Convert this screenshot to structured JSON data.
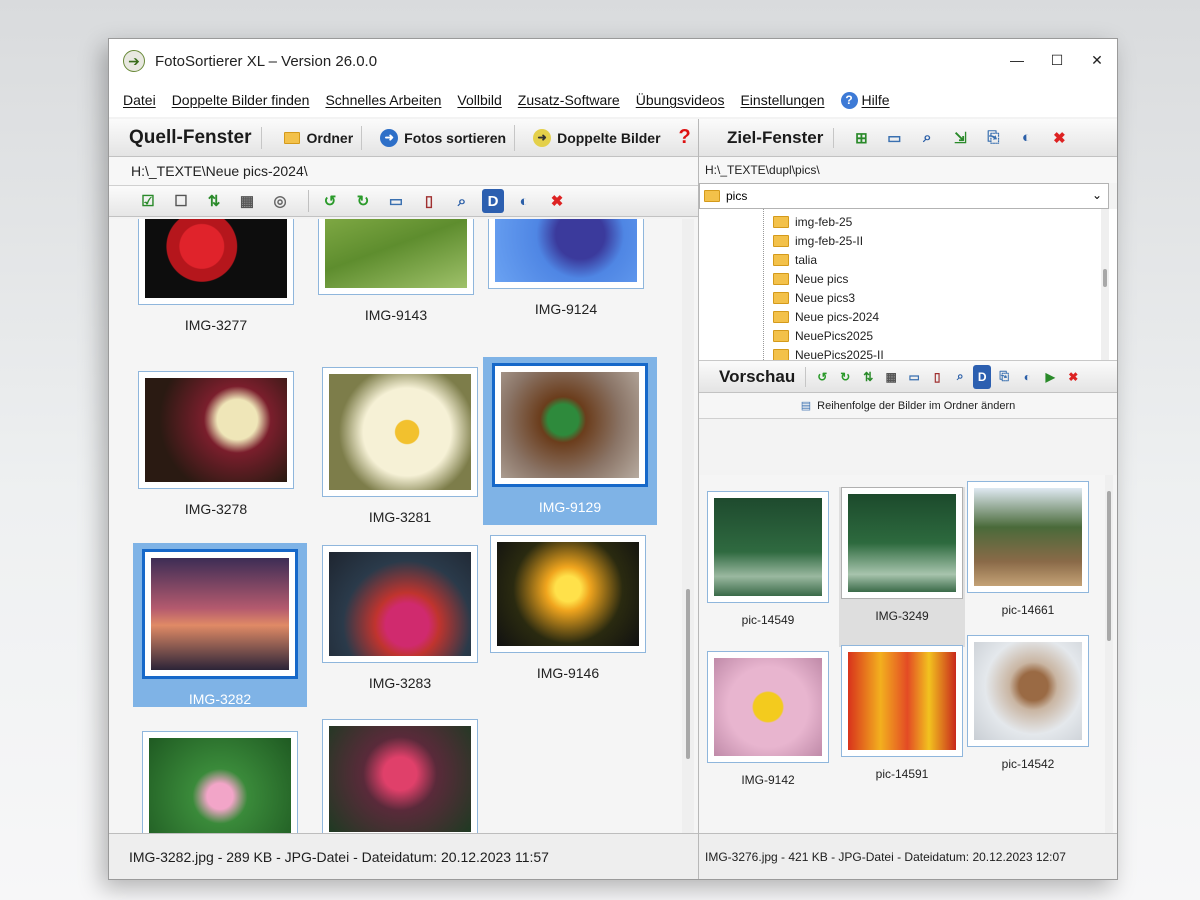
{
  "window": {
    "title": "FotoSortierer XL – Version 26.0.0",
    "controls": {
      "minimize": "—",
      "maximize": "☐",
      "close": "✕"
    }
  },
  "menu": {
    "items": [
      "Datei",
      "Doppelte Bilder finden",
      "Schnelles Arbeiten",
      "Vollbild",
      "Zusatz-Software",
      "Übungsvideos",
      "Einstellungen"
    ],
    "help": "Hilfe"
  },
  "source": {
    "title": "Quell-Fenster",
    "btn_folder": "Ordner",
    "btn_sort": "Fotos sortieren",
    "btn_duplicates": "Doppelte Bilder",
    "path": "H:\\_TEXTE\\Neue pics-2024\\",
    "thumbs": [
      {
        "name": "IMG-3277",
        "selected": false
      },
      {
        "name": "IMG-9143",
        "selected": false
      },
      {
        "name": "IMG-9124",
        "selected": false
      },
      {
        "name": "IMG-3278",
        "selected": false
      },
      {
        "name": "IMG-3281",
        "selected": false
      },
      {
        "name": "IMG-9129",
        "selected": true
      },
      {
        "name": "IMG-3282",
        "selected": true
      },
      {
        "name": "IMG-3283",
        "selected": false
      },
      {
        "name": "IMG-9146",
        "selected": false
      },
      {
        "name": "",
        "selected": false
      },
      {
        "name": "",
        "selected": false
      }
    ],
    "status": "IMG-3282.jpg - 289 KB - JPG-Datei - Dateidatum: 20.12.2023 11:57"
  },
  "target": {
    "title": "Ziel-Fenster",
    "path": "H:\\_TEXTE\\dupl\\pics\\",
    "combo_value": "pics",
    "folders": [
      "img-feb-25",
      "img-feb-25-II",
      "talia",
      "Neue pics",
      "Neue pics3",
      "Neue pics-2024",
      "NeuePics2025",
      "NeuePics2025-II"
    ]
  },
  "preview": {
    "title": "Vorschau",
    "reorder_label": "Reihenfolge der Bilder im Ordner ändern",
    "thumbs": [
      {
        "name": "pic-14549",
        "selected": false
      },
      {
        "name": "IMG-3249",
        "selected": true
      },
      {
        "name": "pic-14661",
        "selected": false
      },
      {
        "name": "IMG-9142",
        "selected": false
      },
      {
        "name": "pic-14591",
        "selected": false
      },
      {
        "name": "pic-14542",
        "selected": false
      }
    ],
    "status": "IMG-3276.jpg - 421 KB - JPG-Datei - Dateidatum: 20.12.2023 12:07"
  }
}
